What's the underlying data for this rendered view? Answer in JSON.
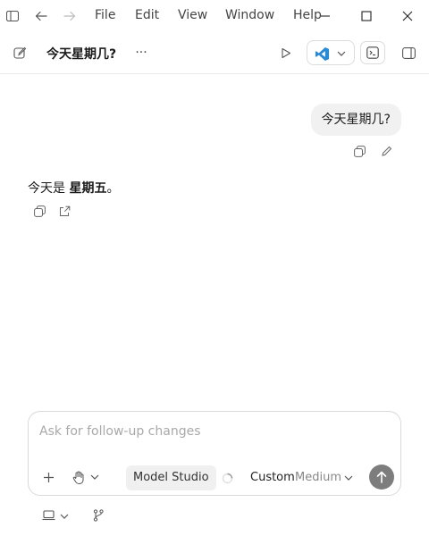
{
  "menu": {
    "items": [
      "File",
      "Edit",
      "View",
      "Window",
      "Help"
    ]
  },
  "header": {
    "title": "今天星期几?",
    "more": "···"
  },
  "conversation": {
    "user_message": "今天星期几?",
    "assistant_prefix": "今天是 ",
    "assistant_bold": "星期五",
    "assistant_suffix": "。"
  },
  "composer": {
    "placeholder": "Ask for follow-up changes",
    "model": "Model Studio",
    "mode": "Custom",
    "effort": "Medium"
  },
  "colors": {
    "accent_vscode": "#2a8ad4",
    "send_button": "#7d7d7d",
    "bubble_bg": "#f1f1f1"
  },
  "icons": [
    "sidebar-toggle-icon",
    "back-arrow-icon",
    "forward-arrow-icon",
    "minimize-icon",
    "maximize-icon",
    "close-icon",
    "new-chat-icon",
    "more-icon",
    "run-icon",
    "vscode-icon",
    "chevron-down-icon",
    "terminal-icon",
    "panel-toggle-icon",
    "copy-icon",
    "edit-icon",
    "share-icon",
    "plus-icon",
    "hand-icon",
    "spinner-icon",
    "send-arrow-icon",
    "laptop-icon",
    "branch-icon"
  ]
}
